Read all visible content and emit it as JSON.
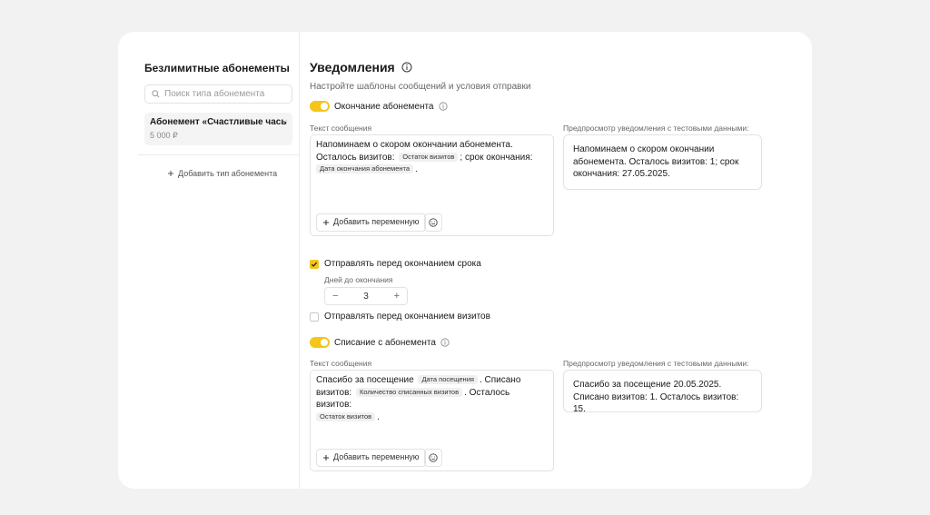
{
  "sidebar": {
    "title": "Безлимитные абонементы",
    "search_placeholder": "Поиск типа абонемента",
    "items": [
      {
        "name": "Абонемент «Счастливые часы»",
        "price": "5 000 ₽"
      }
    ],
    "add_label": "Добавить тип абонемента"
  },
  "header": {
    "title": "Уведомления",
    "subtitle": "Настройте шаблоны сообщений и условия отправки"
  },
  "section1": {
    "toggle_label": "Окончание абонемента",
    "toggle_on": true,
    "message_label": "Текст сообщения",
    "preview_label": "Предпросмотр уведомления с тестовыми данными:",
    "msg_line1": "Напоминаем о скором окончании абонемента.",
    "msg_part2": "Осталось визитов:",
    "tag1": "Остаток визитов",
    "msg_part3": "; срок окончания:",
    "tag2": "Дата окончания абонемента",
    "msg_end": ".",
    "add_variable": "Добавить переменную",
    "preview_text": "Напоминаем о скором окончании абонемента. Осталось визитов: 1; срок окончания: 27.05.2025."
  },
  "options": {
    "before_end_label": "Отправлять перед окончанием срока",
    "before_end_checked": true,
    "days_label": "Дней до окончания",
    "days_value": "3",
    "before_visits_label": "Отправлять перед окончанием визитов",
    "before_visits_checked": false
  },
  "section2": {
    "toggle_label": "Списание с абонемента",
    "toggle_on": true,
    "message_label": "Текст сообщения",
    "preview_label": "Предпросмотр уведомления с тестовыми данными:",
    "msg_part1": "Спасибо за посещение",
    "tag1": "Дата посещения",
    "msg_part2": ". Списано визитов:",
    "tag2": "Количество списанных визитов",
    "msg_part3": ". Осталось визитов:",
    "tag3": "Остаток визитов",
    "msg_end": ".",
    "add_variable": "Добавить переменную",
    "preview_text": "Спасибо за посещение 20.05.2025. Списано визитов: 1. Осталось визитов: 15."
  },
  "colors": {
    "accent": "#f5c518",
    "background": "#f2f2f2"
  }
}
